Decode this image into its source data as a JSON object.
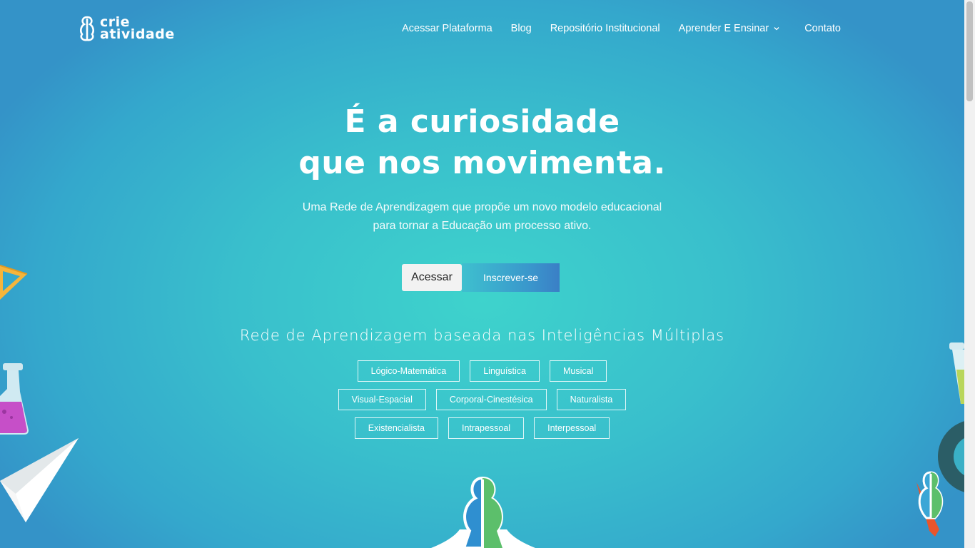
{
  "brand": {
    "line1": "crie",
    "line2": "atividade"
  },
  "nav": {
    "items": [
      "Acessar Plataforma",
      "Blog",
      "Repositório Institucional",
      "Aprender E Ensinar"
    ],
    "contact": "Contato"
  },
  "hero": {
    "title_line1": "É a curiosidade",
    "title_line2": "que nos movimenta.",
    "subtitle_line1": "Uma Rede de Aprendizagem que propõe um novo modelo educacional",
    "subtitle_line2": "para tornar a Educação um processo ativo.",
    "btn_access": "Acessar",
    "btn_signup": "Inscrever-se"
  },
  "intelligences": {
    "title": "Rede de Aprendizagem baseada nas Inteligências Múltiplas",
    "row1": [
      "Lógico-Matemática",
      "Linguística",
      "Musical"
    ],
    "row2": [
      "Visual-Espacial",
      "Corporal-Cinestésica",
      "Naturalista"
    ],
    "row3": [
      "Existencialista",
      "Intrapessoal",
      "Interpessoal"
    ]
  },
  "colors": {
    "bg_center": "#3ed3cc",
    "bg_edge": "#3493c8",
    "button_light": "#f2f2f2",
    "accent_green": "#5cbf6b"
  },
  "icons": [
    "chevron-down-icon",
    "protractor-icon",
    "flask-icon",
    "paper-plane-icon",
    "brand-mascot-icon"
  ]
}
